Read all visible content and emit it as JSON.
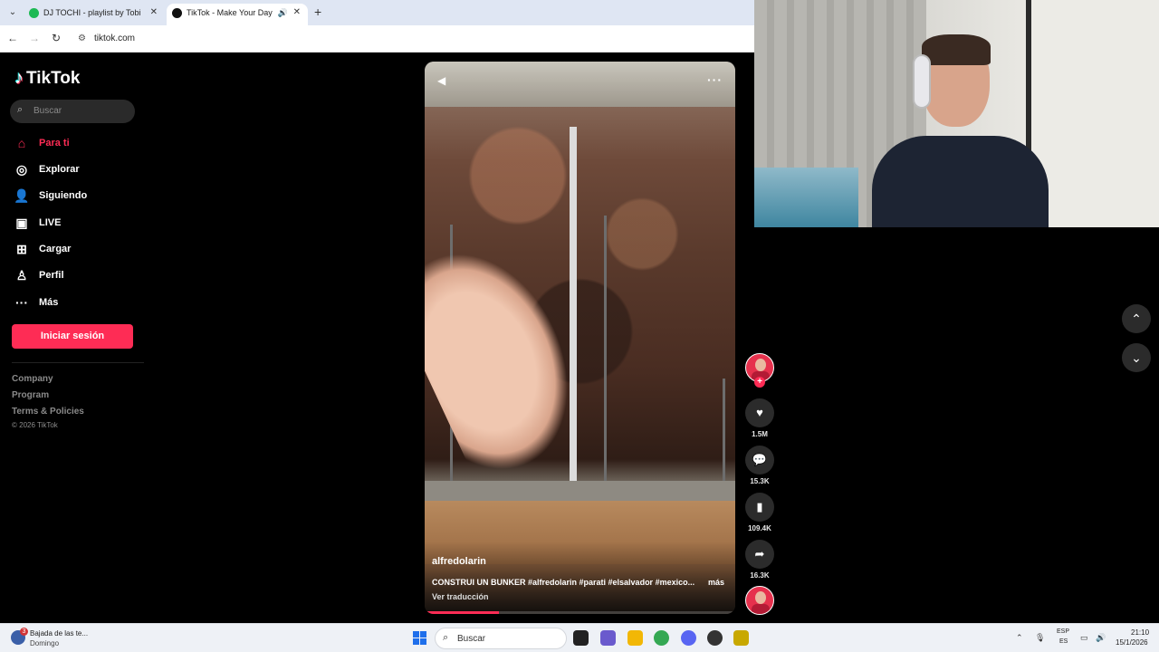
{
  "browser": {
    "tabs": [
      {
        "title": "DJ TOCHI - playlist by Tobi Sanc",
        "favicon_color": "#1db954"
      },
      {
        "title": "TikTok - Make Your Day",
        "favicon_color": "#111111"
      }
    ],
    "url": "tiktok.com"
  },
  "tiktok": {
    "logo_text": "TikTok",
    "search_placeholder": "Buscar",
    "nav": [
      {
        "label": "Para ti",
        "icon": "home-icon",
        "active": true
      },
      {
        "label": "Explorar",
        "icon": "compass-icon"
      },
      {
        "label": "Siguiendo",
        "icon": "following-icon"
      },
      {
        "label": "LIVE",
        "icon": "live-icon"
      },
      {
        "label": "Cargar",
        "icon": "upload-icon"
      },
      {
        "label": "Perfil",
        "icon": "profile-icon"
      },
      {
        "label": "Más",
        "icon": "more-icon"
      }
    ],
    "login_label": "Iniciar sesión",
    "footer": [
      "Company",
      "Program",
      "Terms & Policies"
    ],
    "copyright": "© 2026 TikTok",
    "accent": "#fe2c55"
  },
  "video": {
    "author": "alfredolarin",
    "caption": "CONSTRUI UN BUNKER #alfredolarin #parati #elsalvador #mexico...",
    "more": "más",
    "translate": "Ver traducción",
    "progress": 0.24
  },
  "actions": {
    "likes": "1.5M",
    "comments": "15.3K",
    "saves": "109.4K",
    "shares": "16.3K"
  },
  "taskbar": {
    "weather_title": "Bajada de las te...",
    "weather_sub": "Domingo",
    "weather_badge": "3",
    "search": "Buscar",
    "lang1": "ESP",
    "lang2": "ES",
    "time": "21:10",
    "date": "15/1/2026"
  }
}
